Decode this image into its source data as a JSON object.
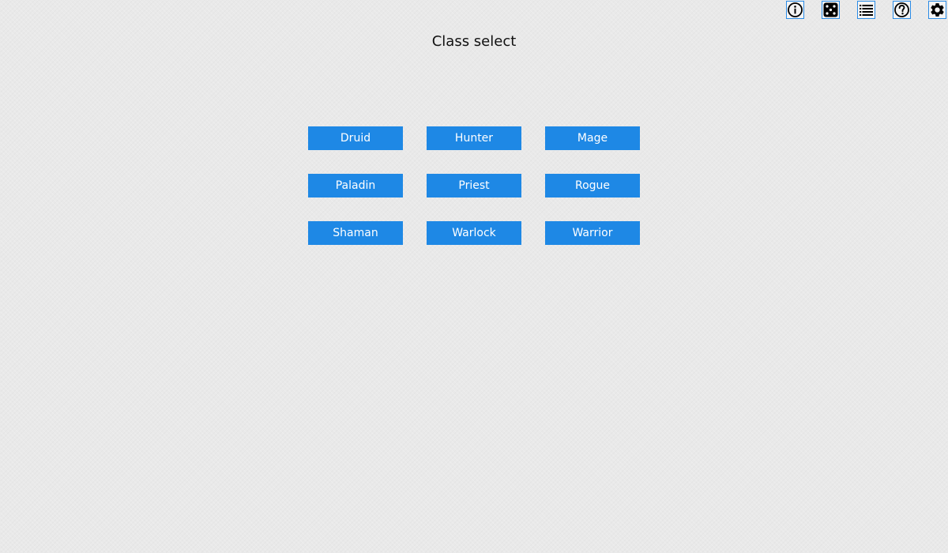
{
  "title": "Class select",
  "toolbar": {
    "icons": [
      "info-icon",
      "dice-icon",
      "list-icon",
      "help-icon",
      "gear-icon"
    ]
  },
  "classes": [
    {
      "label": "Druid"
    },
    {
      "label": "Hunter"
    },
    {
      "label": "Mage"
    },
    {
      "label": "Paladin"
    },
    {
      "label": "Priest"
    },
    {
      "label": "Rogue"
    },
    {
      "label": "Shaman"
    },
    {
      "label": "Warlock"
    },
    {
      "label": "Warrior"
    }
  ],
  "colors": {
    "button": "#1e88e5",
    "button_text": "#ffffff",
    "background": "#e9e9e9",
    "toolbar_border": "#2a8be6"
  }
}
